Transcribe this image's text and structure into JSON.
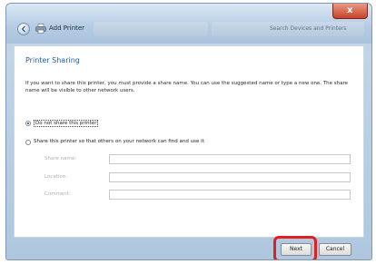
{
  "window": {
    "title": "Add Printer",
    "close_symbol": "x",
    "address_bar_text": "Search Devices and Printers"
  },
  "page": {
    "heading": "Printer Sharing",
    "description": "If you want to share this printer, you must provide a share name. You can use the suggested name or type a new one. The share name will be visible to other network users.",
    "options": [
      {
        "label": "Do not share this printer",
        "selected": true
      },
      {
        "label": "Share this printer so that others on your network can find and use it",
        "selected": false
      }
    ],
    "fields": {
      "share_name": {
        "label": "Share name:",
        "value": ""
      },
      "location": {
        "label": "Location:",
        "value": ""
      },
      "comment": {
        "label": "Comment:",
        "value": ""
      }
    }
  },
  "buttons": {
    "next": "Next",
    "cancel": "Cancel"
  },
  "highlight_color": "#e01f1f"
}
